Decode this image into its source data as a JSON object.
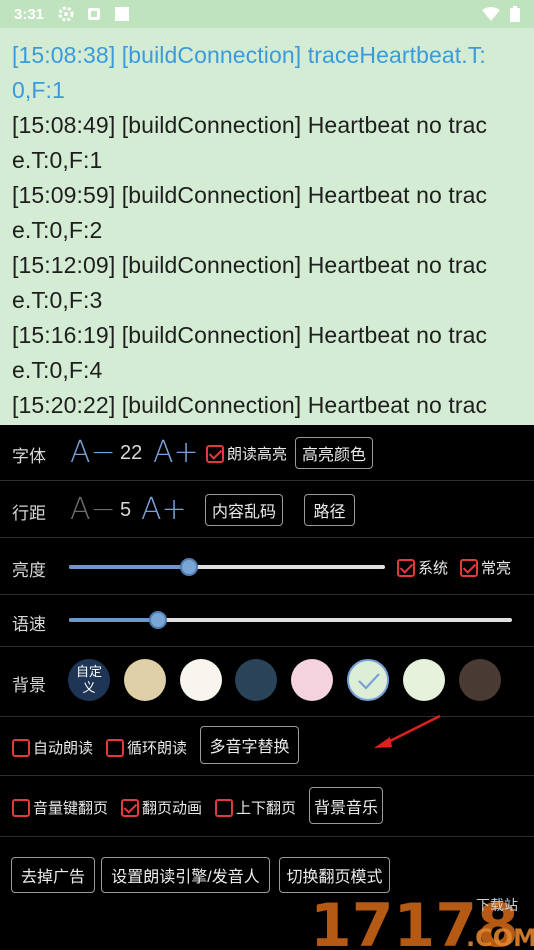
{
  "status": {
    "time": "3:31"
  },
  "reader": {
    "lines": [
      {
        "text": "[15:08:38] [buildConnection] traceHeartbeat.T:",
        "highlight": true
      },
      {
        "text": "0,F:1",
        "highlight": true
      },
      {
        "text": "[15:08:49] [buildConnection] Heartbeat no trac",
        "highlight": false
      },
      {
        "text": "e.T:0,F:1",
        "highlight": false
      },
      {
        "text": "[15:09:59] [buildConnection] Heartbeat no trac",
        "highlight": false
      },
      {
        "text": "e.T:0,F:2",
        "highlight": false
      },
      {
        "text": "[15:12:09] [buildConnection] Heartbeat no trac",
        "highlight": false
      },
      {
        "text": "e.T:0,F:3",
        "highlight": false
      },
      {
        "text": "[15:16:19] [buildConnection] Heartbeat no trac",
        "highlight": false
      },
      {
        "text": "e.T:0,F:4",
        "highlight": false
      },
      {
        "text": "[15:20:22] [buildConnection] Heartbeat no trac",
        "highlight": false
      }
    ],
    "colors": {
      "background": "#d5ecd4",
      "text": "#1e1e1e",
      "highlight": "#3a9bdc"
    }
  },
  "settings": {
    "font": {
      "label": "字体",
      "decrease": "A−",
      "value": "22",
      "increase": "A+",
      "read_highlight": {
        "label": "朗读高亮",
        "checked": true
      },
      "highlight_color_btn": "高亮颜色"
    },
    "spacing": {
      "label": "行距",
      "decrease": "A−",
      "value": "5",
      "increase": "A+",
      "garbled_btn": "内容乱码",
      "path_btn": "路径"
    },
    "brightness": {
      "label": "亮度",
      "value": 0.38,
      "system": {
        "label": "系统",
        "checked": true
      },
      "keep_on": {
        "label": "常亮",
        "checked": true
      }
    },
    "speed": {
      "label": "语速",
      "value": 0.2
    },
    "background": {
      "label": "背景",
      "custom_label": "自定义",
      "swatches": [
        "#1f3556",
        "#dfd0a8",
        "#f8f5ee",
        "#2a4358",
        "#f5d3de",
        "#dcefd6",
        "#e6f2dc",
        "#4a3a34"
      ],
      "selected_index": 5
    },
    "options1": {
      "auto_read": {
        "label": "自动朗读",
        "checked": false
      },
      "loop_read": {
        "label": "循环朗读",
        "checked": false
      },
      "polyphone_btn": "多音字替换"
    },
    "options2": {
      "volume_key": {
        "label": "音量键翻页",
        "checked": false
      },
      "page_anim": {
        "label": "翻页动画",
        "checked": true
      },
      "vertical": {
        "label": "上下翻页",
        "checked": false
      },
      "bg_music_btn": "背景音乐"
    },
    "actions": {
      "remove_ads": "去掉广告",
      "tts_engine": "设置朗读引擎/发音人",
      "switch_mode": "切换翻页模式"
    }
  },
  "watermark": {
    "number": "17178",
    "sub1": "下载站",
    "sub2": ".COM"
  }
}
